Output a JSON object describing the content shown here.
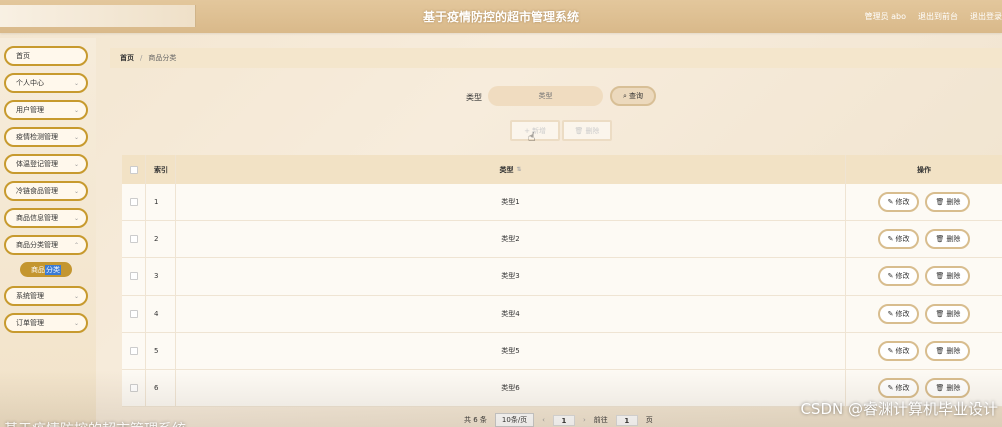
{
  "header": {
    "title": "基于疫情防控的超市管理系统",
    "links": [
      "管理员 abo",
      "退出到前台",
      "退出登录"
    ]
  },
  "sidebar": {
    "items": [
      {
        "label": "首页",
        "chevron": false
      },
      {
        "label": "个人中心",
        "chevron": true
      },
      {
        "label": "用户管理",
        "chevron": true
      },
      {
        "label": "疫情检测管理",
        "chevron": true
      },
      {
        "label": "体温登记管理",
        "chevron": true
      },
      {
        "label": "冷链食品管理",
        "chevron": true
      },
      {
        "label": "商品信息管理",
        "chevron": true
      },
      {
        "label": "商品分类管理",
        "chevron": true
      },
      {
        "label": "系统管理",
        "chevron": true
      },
      {
        "label": "订单管理",
        "chevron": true
      }
    ],
    "active_sub": {
      "label_a": "商品",
      "label_b": "分类"
    }
  },
  "breadcrumb": {
    "home": "首页",
    "separator": "/",
    "current": "商品分类"
  },
  "search": {
    "label": "类型",
    "placeholder": "类型",
    "button": "查询"
  },
  "actions": {
    "add": "新增",
    "delete": "删除"
  },
  "table": {
    "headers": {
      "index": "索引",
      "type": "类型",
      "ops": "操作"
    },
    "rows": [
      {
        "index": "1",
        "type": "类型1"
      },
      {
        "index": "2",
        "type": "类型2"
      },
      {
        "index": "3",
        "type": "类型3"
      },
      {
        "index": "4",
        "type": "类型4"
      },
      {
        "index": "5",
        "type": "类型5"
      },
      {
        "index": "6",
        "type": "类型6"
      }
    ],
    "edit_label": "修改",
    "delete_label": "删除"
  },
  "pagination": {
    "total": "共 6 条",
    "page_size": "10条/页",
    "current": "1",
    "goto_label": "前往",
    "goto_value": "1",
    "page_suffix": "页"
  },
  "overlay": {
    "caption": "基于疫情防控的超市管理系统",
    "watermark": "CSDN @睿渊计算机毕业设计"
  },
  "colors": {
    "accent": "#c79a2e",
    "header": "#d9b98a",
    "active_sub": "#c4962f"
  }
}
